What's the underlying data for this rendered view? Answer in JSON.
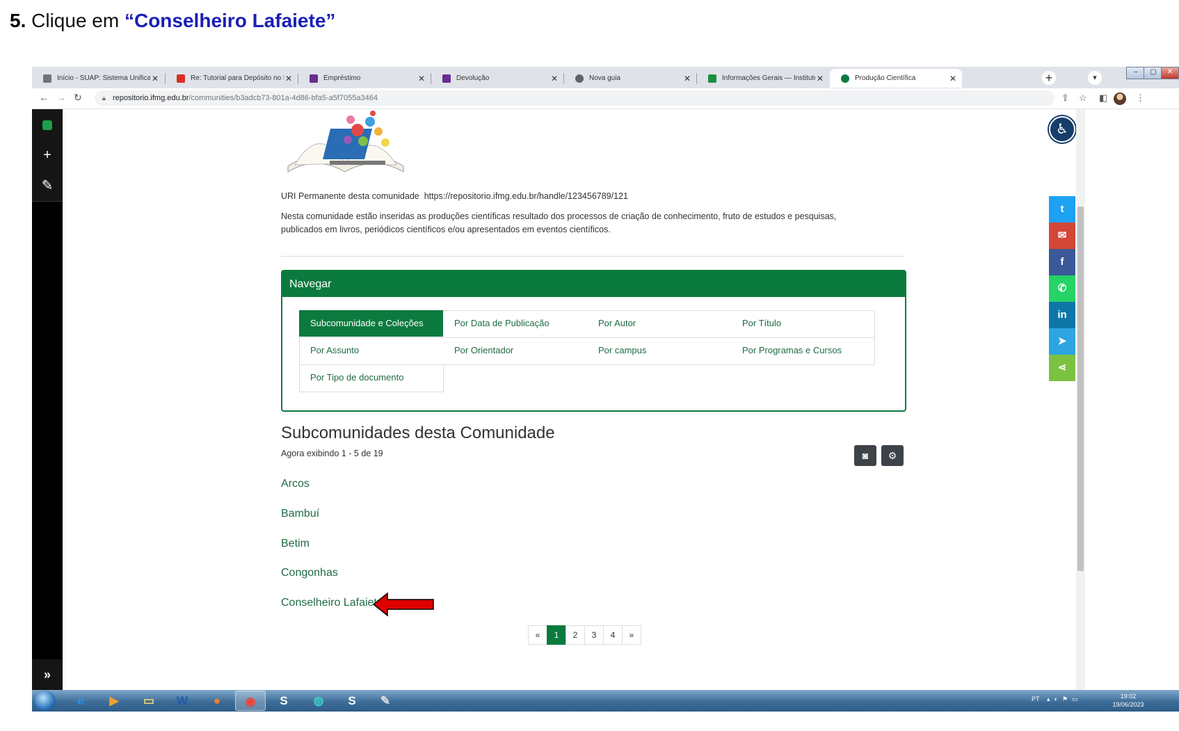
{
  "step": {
    "number": "5.",
    "text": " Clique em ",
    "highlight": "“Conselheiro Lafaiete”"
  },
  "browser": {
    "tabs": [
      {
        "title": "Início - SUAP: Sistema Unificado",
        "favicon_color": "#6c757d"
      },
      {
        "title": "Re: Tutorial para Depósito no RI-I",
        "favicon_color": "#d93025"
      },
      {
        "title": "Empréstimo",
        "favicon_color": "#6a2c91"
      },
      {
        "title": "Devolução",
        "favicon_color": "#6a2c91"
      },
      {
        "title": "Nova guia",
        "favicon_color": "#5f6368"
      },
      {
        "title": "Informações Gerais — Instituto F",
        "favicon_color": "#1e8e3e"
      },
      {
        "title": "Produção Científica",
        "favicon_color": "#0b7a3e",
        "active": true
      }
    ],
    "new_tab_icon": "+",
    "url_host": "repositorio.ifmg.edu.br",
    "url_path": "/communities/b3adcb73-801a-4d86-bfa5-a5f7055a3464"
  },
  "left_toolbar": {
    "add_icon": "+",
    "edit_icon": "✎",
    "expand_icon": "»"
  },
  "page": {
    "uri_label": "URI Permanente desta comunidade",
    "uri_value": "https://repositorio.ifmg.edu.br/handle/123456789/121",
    "description_line1": "Nesta comunidade estão inseridas as produções científicas resultado dos processos de criação de conhecimento, fruto de estudos e pesquisas,",
    "description_line2": "publicados em livros, periódicos científicos e/ou apresentados em eventos científicos.",
    "browse": {
      "title": "Navegar",
      "options": [
        "Subcomunidade e Coleções",
        "Por Data de Publicação",
        "Por Autor",
        "Por Título",
        "Por Assunto",
        "Por Orientador",
        "Por campus",
        "Por Programas e Cursos",
        "Por Tipo de documento"
      ],
      "active_index": 0
    },
    "subcommunities_title": "Subcomunidades desta Comunidade",
    "showing_text": "Agora exibindo 1 - 5 de 19",
    "subcommunities": [
      "Arcos",
      "Bambuí",
      "Betim",
      "Congonhas",
      "Conselheiro Lafaiete"
    ],
    "pagination": [
      "«",
      "1",
      "2",
      "3",
      "4",
      "»"
    ],
    "current_page": "1"
  },
  "share_buttons": [
    {
      "name": "twitter-share-button",
      "icon": "twitter-icon",
      "glyph": "t",
      "color": "#1da1f2"
    },
    {
      "name": "email-share-button",
      "icon": "envelope-icon",
      "glyph": "✉",
      "color": "#d44638"
    },
    {
      "name": "facebook-share-button",
      "icon": "facebook-icon",
      "glyph": "f",
      "color": "#3b5998"
    },
    {
      "name": "whatsapp-share-button",
      "icon": "whatsapp-icon",
      "glyph": "✆",
      "color": "#25d366"
    },
    {
      "name": "linkedin-share-button",
      "icon": "linkedin-icon",
      "glyph": "in",
      "color": "#0e76a8"
    },
    {
      "name": "telegram-share-button",
      "icon": "telegram-icon",
      "glyph": "➤",
      "color": "#2ca5e0"
    },
    {
      "name": "generic-share-button",
      "icon": "share-icon",
      "glyph": "⋖",
      "color": "#7cc242"
    }
  ],
  "taskbar": {
    "language": "PT",
    "time": "19:02",
    "date": "19/06/2023"
  },
  "colors": {
    "accent_green": "#0b7a3e",
    "arrow_red": "#e00000",
    "step_blue": "#1b1fb5"
  }
}
